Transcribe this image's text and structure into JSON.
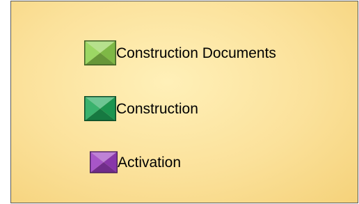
{
  "legend": {
    "items": [
      {
        "label": "Construction Documents",
        "color": "#8fd14f",
        "icon": "bevel-square-icon"
      },
      {
        "label": "Construction",
        "color": "#1fa85a",
        "icon": "bevel-square-icon"
      },
      {
        "label": "Activation",
        "color": "#9b3fc0",
        "icon": "bevel-square-icon"
      }
    ]
  }
}
